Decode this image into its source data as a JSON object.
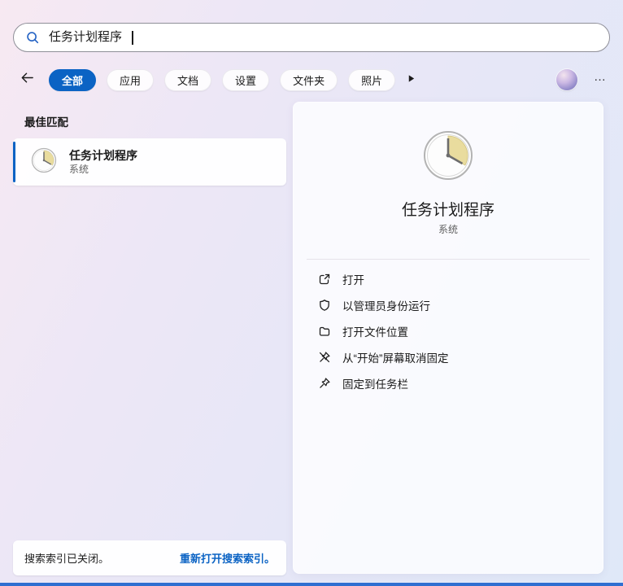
{
  "search": {
    "query": "任务计划程序",
    "icon": "search-icon"
  },
  "toolbar": {
    "back_icon": "arrow-left-icon",
    "tabs": [
      {
        "label": "全部",
        "selected": true
      },
      {
        "label": "应用",
        "selected": false
      },
      {
        "label": "文档",
        "selected": false
      },
      {
        "label": "设置",
        "selected": false
      },
      {
        "label": "文件夹",
        "selected": false
      },
      {
        "label": "照片",
        "selected": false
      }
    ],
    "overflow_icon": "play-triangle-icon",
    "more_label": "…"
  },
  "results": {
    "section_title": "最佳匹配",
    "best_match": {
      "title": "任务计划程序",
      "subtitle": "系统",
      "icon": "task-scheduler-clock-icon"
    }
  },
  "preview": {
    "icon": "task-scheduler-clock-icon",
    "title": "任务计划程序",
    "subtitle": "系统",
    "actions": [
      {
        "label": "打开",
        "icon": "open-icon"
      },
      {
        "label": "以管理员身份运行",
        "icon": "admin-shield-icon"
      },
      {
        "label": "打开文件位置",
        "icon": "folder-icon"
      },
      {
        "label": "从“开始”屏幕取消固定",
        "icon": "unpin-icon"
      },
      {
        "label": "固定到任务栏",
        "icon": "pin-icon"
      }
    ]
  },
  "statusbar": {
    "message": "搜索索引已关闭。",
    "link_label": "重新打开搜索索引。"
  },
  "colors": {
    "accent": "#0b63c4",
    "link": "#0b63c4",
    "text": "#1b1b1b",
    "subtitle": "#5f5f5f",
    "clock_wedge": "#e9dc9e",
    "bottom_strip": "#2f6fd1"
  }
}
